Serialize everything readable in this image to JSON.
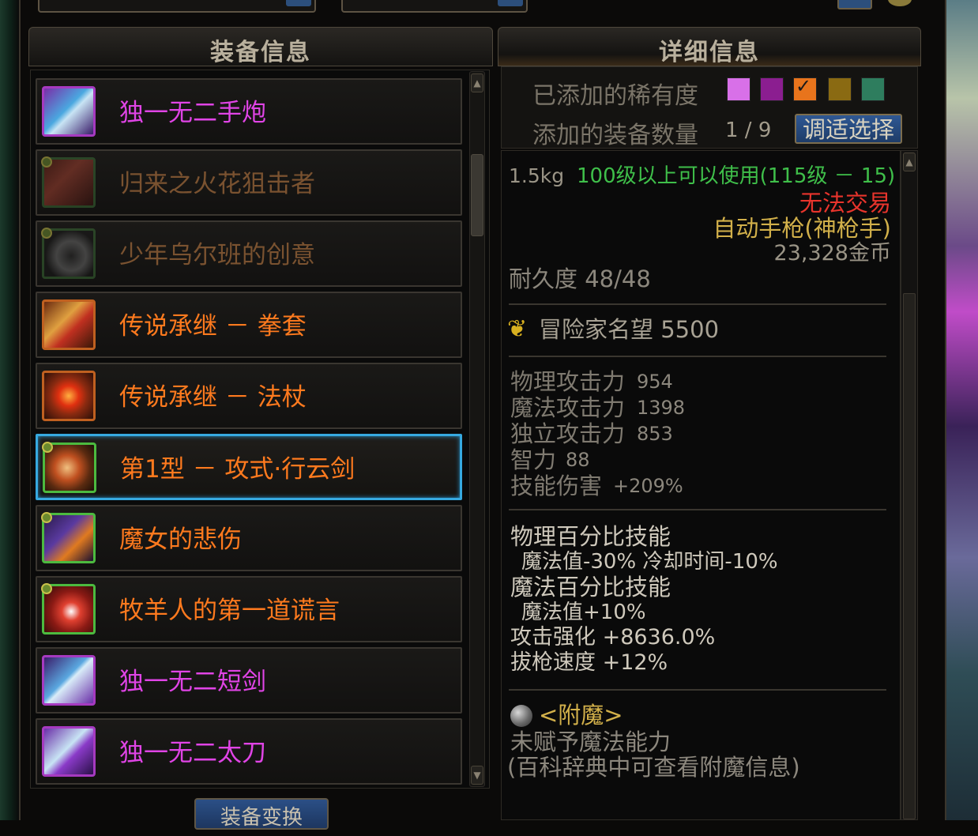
{
  "left_panel": {
    "title": "装备信息",
    "items": [
      {
        "name": "独一无二手炮",
        "color": "#e044e6"
      },
      {
        "name": "归来之火花狙击者",
        "color": "#7a5230"
      },
      {
        "name": "少年乌尔班的创意",
        "color": "#7a5230"
      },
      {
        "name": "传说承继 － 拳套",
        "color": "#ff7a1e"
      },
      {
        "name": "传说承继 － 法杖",
        "color": "#ff7a1e"
      },
      {
        "name": "第1型 － 攻式·行云剑",
        "color": "#ff7a1e"
      },
      {
        "name": "魔女的悲伤",
        "color": "#ff7a1e"
      },
      {
        "name": "牧羊人的第一道谎言",
        "color": "#ff7a1e"
      },
      {
        "name": "独一无二短剑",
        "color": "#e044e6"
      },
      {
        "name": "独一无二太刀",
        "color": "#e044e6"
      }
    ],
    "bottom_button": "装备变换"
  },
  "right_panel": {
    "title": "详细信息",
    "rarity_label": "已添加的稀有度",
    "count_label": "添加的装备数量",
    "count_value": "1 / 9",
    "adjust_button": "调适选择",
    "rarity_colors": [
      "#d870e8",
      "#8b1e90",
      "#e8741c",
      "#8a6a12",
      "#2e7d5e"
    ],
    "weight": "1.5kg",
    "level_req": "100级以上可以使用(115级 － 15)",
    "trade": "无法交易",
    "item_type": "自动手枪(神枪手)",
    "price": "23,328金币",
    "durability": "耐久度 48/48",
    "fame": "冒险家名望 5500",
    "stats": [
      {
        "label": "物理攻击力",
        "value": "954"
      },
      {
        "label": "魔法攻击力",
        "value": "1398"
      },
      {
        "label": "独立攻击力",
        "value": "853"
      },
      {
        "label": "智力",
        "value": "88"
      },
      {
        "label": "技能伤害",
        "value": "+209%"
      }
    ],
    "skills": {
      "line1": "物理百分比技能",
      "line2": "魔法值-30% 冷却时间-10%",
      "line3": "魔法百分比技能",
      "line4": "魔法值+10%",
      "line5": "攻击强化 +8636.0%",
      "line6": "拔枪速度 +12%"
    },
    "enchant": {
      "title": "<附魔>",
      "line1": "未赋予魔法能力",
      "line2": "(百科辞典中可查看附魔信息)"
    }
  }
}
